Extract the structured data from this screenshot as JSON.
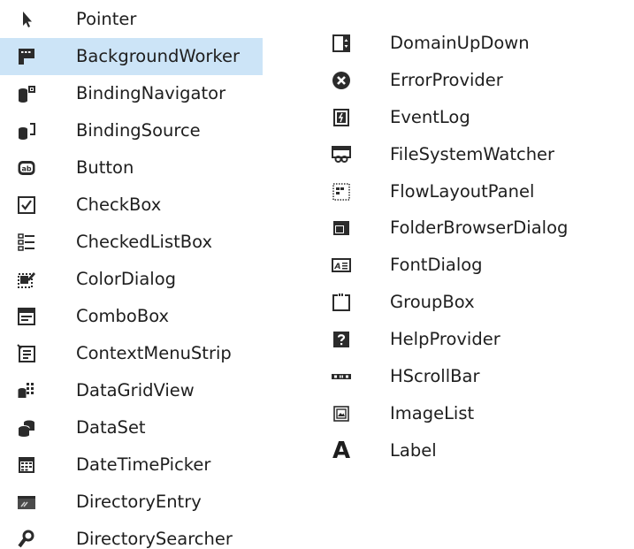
{
  "toolbox": {
    "left_items": [
      {
        "label": "Pointer",
        "icon": "pointer-icon"
      },
      {
        "label": "BackgroundWorker",
        "icon": "background-worker-icon",
        "selected": true
      },
      {
        "label": "BindingNavigator",
        "icon": "binding-navigator-icon"
      },
      {
        "label": "BindingSource",
        "icon": "binding-source-icon"
      },
      {
        "label": "Button",
        "icon": "button-icon"
      },
      {
        "label": "CheckBox",
        "icon": "checkbox-icon"
      },
      {
        "label": "CheckedListBox",
        "icon": "checked-list-box-icon"
      },
      {
        "label": "ColorDialog",
        "icon": "color-dialog-icon"
      },
      {
        "label": "ComboBox",
        "icon": "combobox-icon"
      },
      {
        "label": "ContextMenuStrip",
        "icon": "context-menu-strip-icon"
      },
      {
        "label": "DataGridView",
        "icon": "data-grid-view-icon"
      },
      {
        "label": "DataSet",
        "icon": "dataset-icon"
      },
      {
        "label": "DateTimePicker",
        "icon": "date-time-picker-icon"
      },
      {
        "label": "DirectoryEntry",
        "icon": "directory-entry-icon"
      },
      {
        "label": "DirectorySearcher",
        "icon": "directory-searcher-icon"
      }
    ],
    "right_items": [
      {
        "label": "DomainUpDown",
        "icon": "domain-up-down-icon"
      },
      {
        "label": "ErrorProvider",
        "icon": "error-provider-icon"
      },
      {
        "label": "EventLog",
        "icon": "event-log-icon"
      },
      {
        "label": "FileSystemWatcher",
        "icon": "file-system-watcher-icon"
      },
      {
        "label": "FlowLayoutPanel",
        "icon": "flow-layout-panel-icon"
      },
      {
        "label": "FolderBrowserDialog",
        "icon": "folder-browser-dialog-icon"
      },
      {
        "label": "FontDialog",
        "icon": "font-dialog-icon"
      },
      {
        "label": "GroupBox",
        "icon": "group-box-icon"
      },
      {
        "label": "HelpProvider",
        "icon": "help-provider-icon"
      },
      {
        "label": "HScrollBar",
        "icon": "hscrollbar-icon"
      },
      {
        "label": "ImageList",
        "icon": "image-list-icon"
      },
      {
        "label": "Label",
        "icon": "label-icon",
        "glyph": "A"
      }
    ],
    "colors": {
      "selected_background": "#cce4f7",
      "text": "#1e1e1e",
      "icon": "#2b2b2b"
    }
  }
}
